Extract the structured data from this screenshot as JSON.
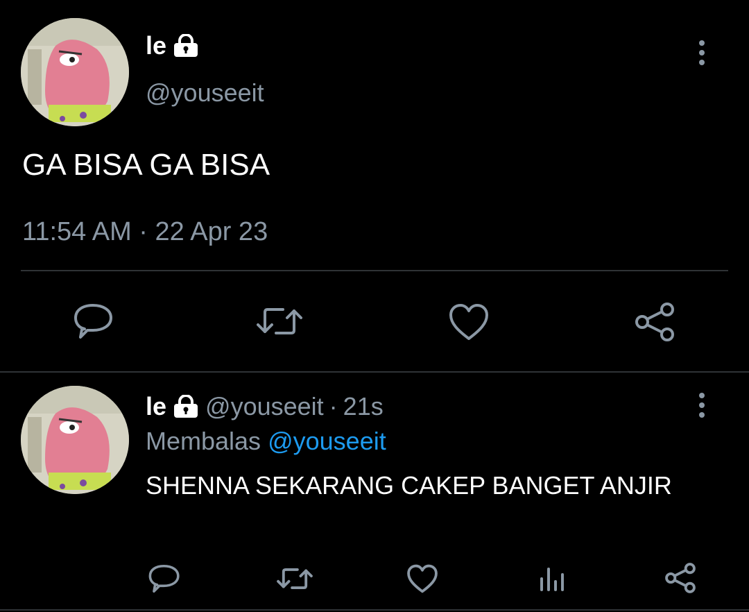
{
  "main_tweet": {
    "display_name": "le",
    "handle": "@youseeit",
    "text": "GA BISA GA BISA",
    "time": "11:54 AM",
    "separator": "·",
    "date": "22 Apr 23",
    "icons": [
      "reply-icon",
      "retweet-icon",
      "like-icon",
      "share-icon"
    ]
  },
  "reply_tweet": {
    "display_name": "le",
    "handle": "@youseeit",
    "separator": "·",
    "age": "21s",
    "replying_to_label": "Membalas",
    "replying_to_handle": "@youseeit",
    "text": "SHENNA SEKARANG CAKEP BANGET ANJIR",
    "icons": [
      "reply-icon",
      "retweet-icon",
      "like-icon",
      "views-icon",
      "share-icon"
    ]
  },
  "colors": {
    "background": "#000000",
    "text": "#ffffff",
    "muted": "#8b98a5",
    "accent": "#1d9bf0",
    "divider": "#2f3336"
  }
}
